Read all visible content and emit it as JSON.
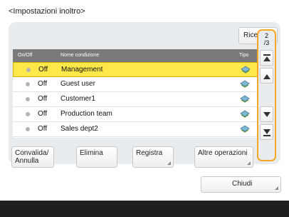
{
  "screen": {
    "title": "<Impostazioni inoltro>"
  },
  "toolbar": {
    "search_label": "Ricerca"
  },
  "list": {
    "columns": {
      "onoff": "On/Off",
      "name": "Nome condizione",
      "type": "Tipo"
    },
    "rows": [
      {
        "state": "Off",
        "name": "Management",
        "selected": true,
        "type_icon": "forward-type-icon"
      },
      {
        "state": "Off",
        "name": "Guest user",
        "selected": false,
        "type_icon": "forward-type-icon"
      },
      {
        "state": "Off",
        "name": "Customer1",
        "selected": false,
        "type_icon": "forward-type-icon"
      },
      {
        "state": "Off",
        "name": "Production team",
        "selected": false,
        "type_icon": "forward-type-icon"
      },
      {
        "state": "Off",
        "name": "Sales dept2",
        "selected": false,
        "type_icon": "forward-type-icon"
      }
    ]
  },
  "pagination": {
    "current": "2",
    "total": "/3"
  },
  "actions": {
    "toggle_label": "Convalida/ Annulla",
    "delete_label": "Elimina",
    "register_label": "Registra",
    "more_label": "Altre operazioni"
  },
  "close_label": "Chiudi",
  "colors": {
    "selection": "#ffe94a",
    "scroll_highlight": "#f5a623",
    "header": "#7a7a7a",
    "footer": "#1f1f1f"
  }
}
